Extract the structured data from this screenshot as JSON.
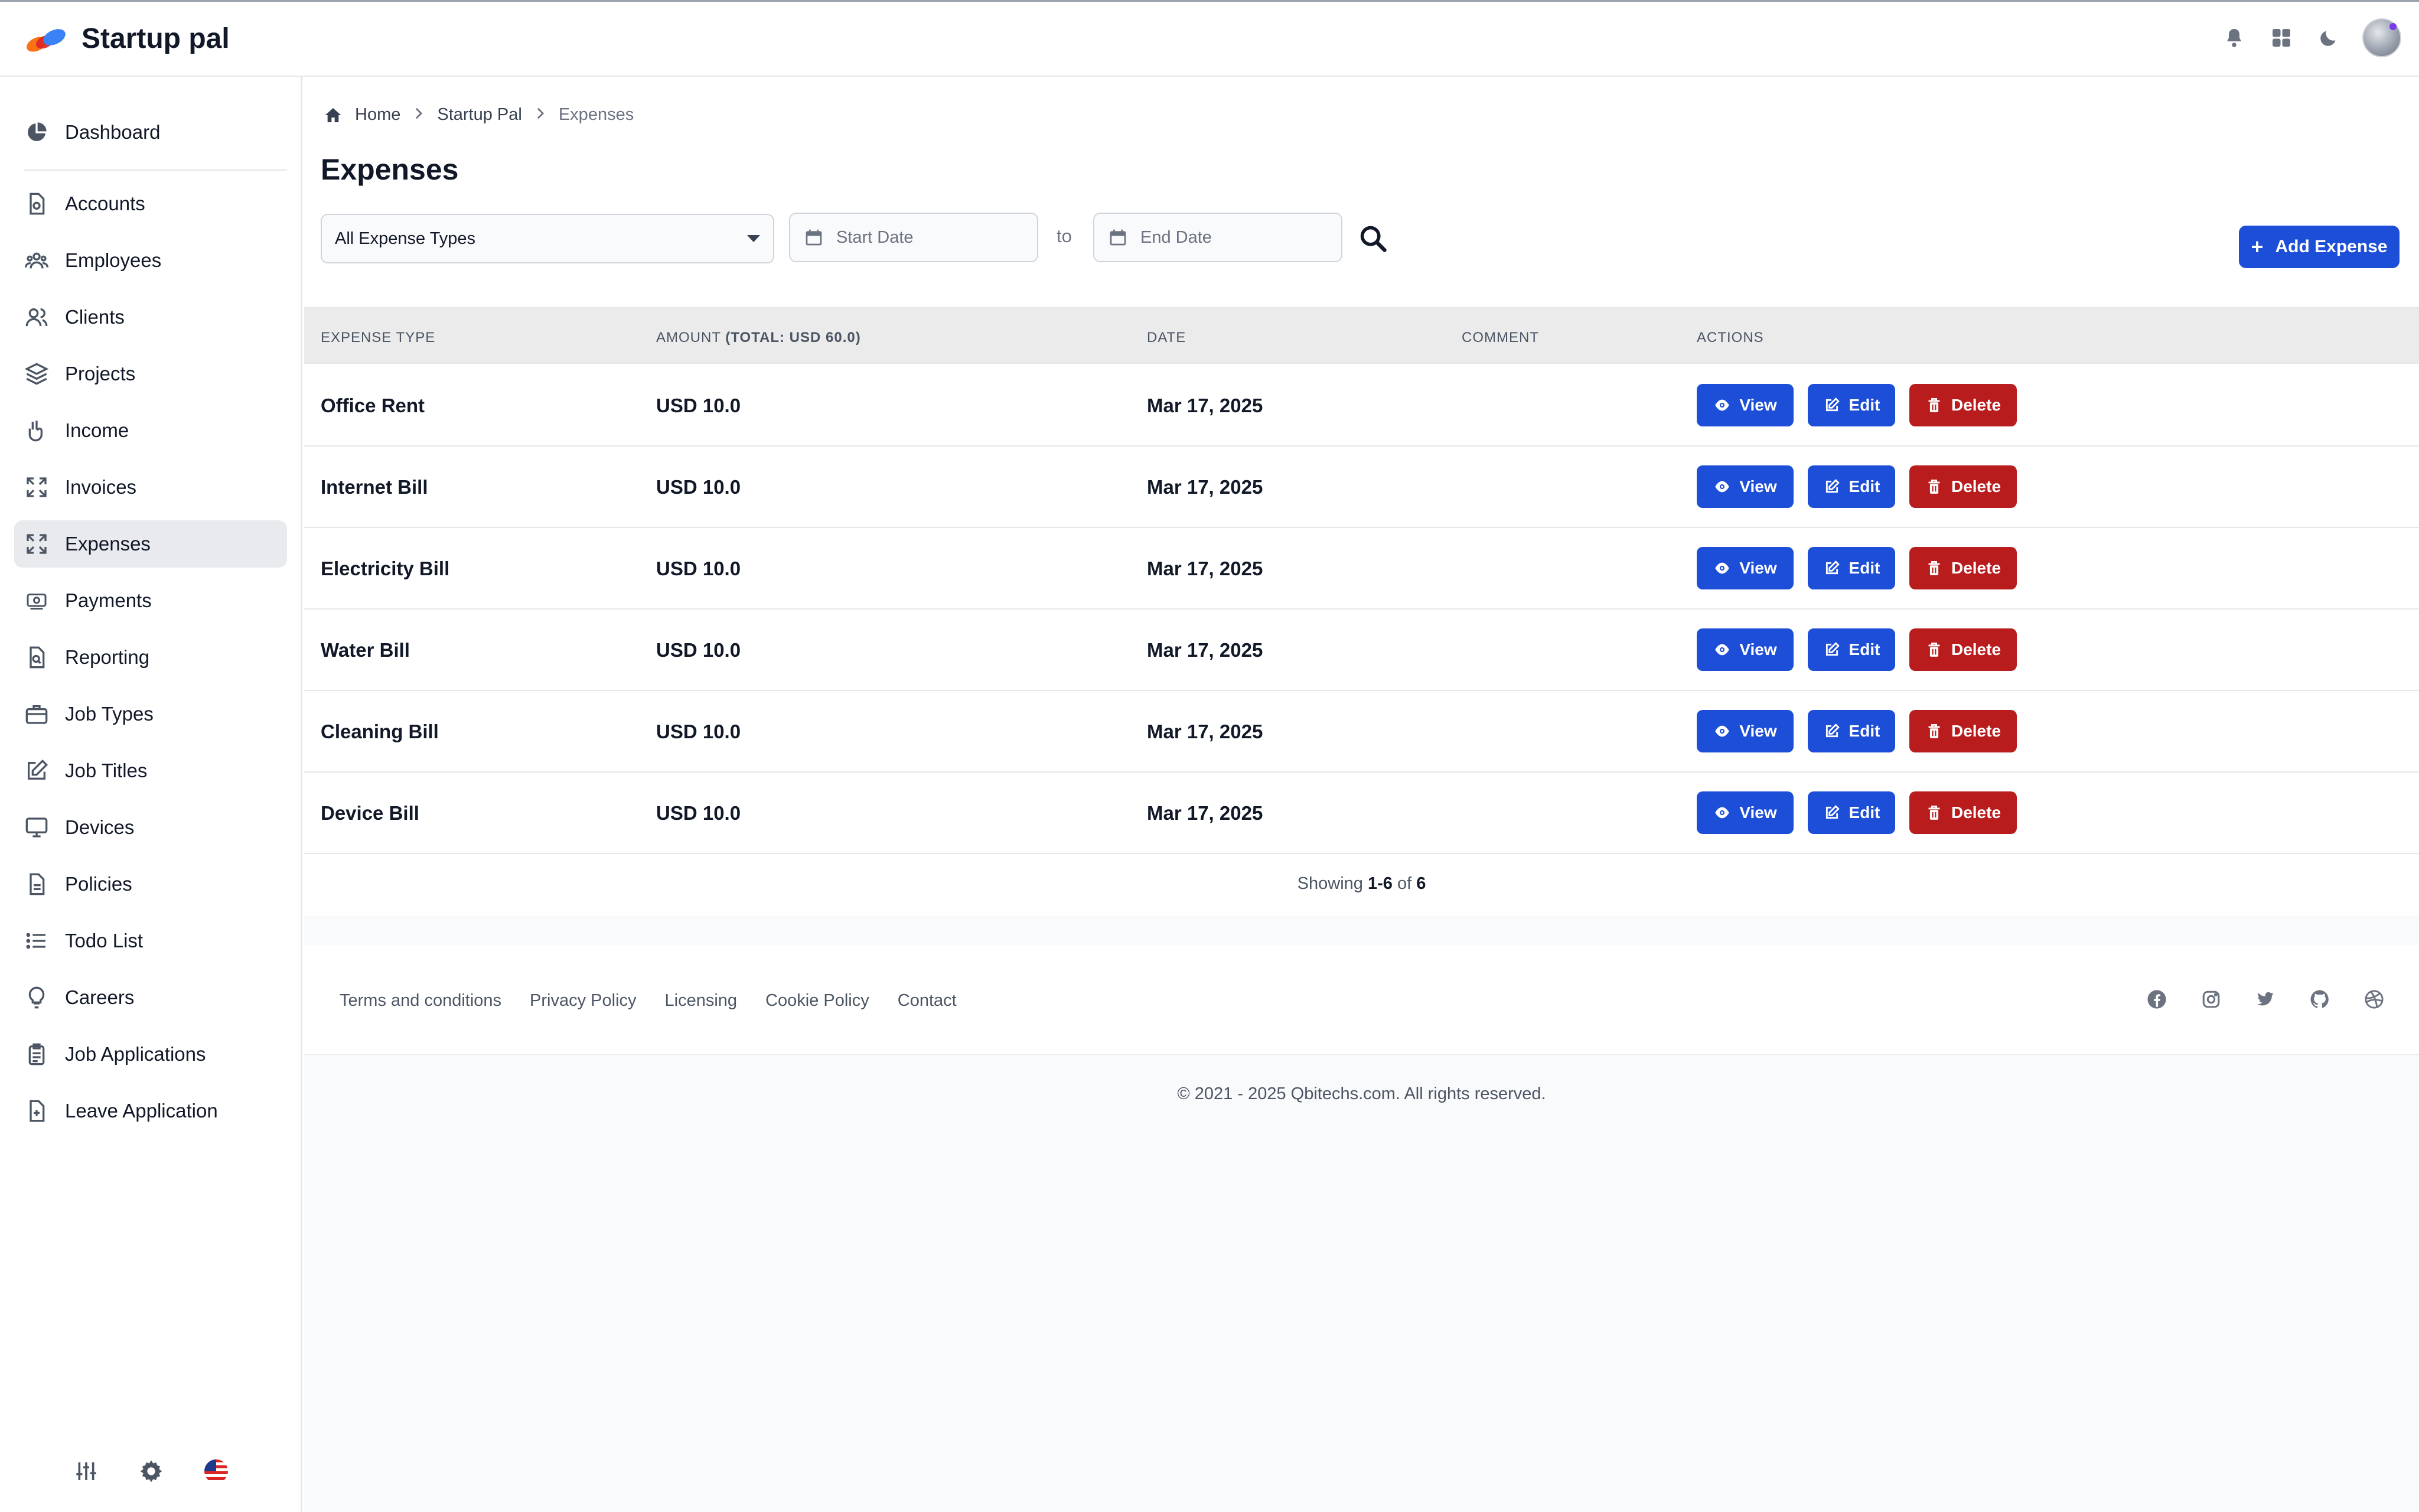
{
  "app": {
    "name": "Startup pal"
  },
  "sidebar": {
    "items": [
      {
        "label": "Dashboard",
        "icon": "pie-chart-icon"
      },
      {
        "label": "Accounts",
        "icon": "document-icon"
      },
      {
        "label": "Employees",
        "icon": "users-icon"
      },
      {
        "label": "Clients",
        "icon": "user-group-icon"
      },
      {
        "label": "Projects",
        "icon": "layers-icon"
      },
      {
        "label": "Income",
        "icon": "hand-coin-icon"
      },
      {
        "label": "Invoices",
        "icon": "expand-icon"
      },
      {
        "label": "Expenses",
        "icon": "expand-icon"
      },
      {
        "label": "Payments",
        "icon": "cash-icon"
      },
      {
        "label": "Reporting",
        "icon": "document-search-icon"
      },
      {
        "label": "Job Types",
        "icon": "briefcase-icon"
      },
      {
        "label": "Job Titles",
        "icon": "pencil-square-icon"
      },
      {
        "label": "Devices",
        "icon": "monitor-icon"
      },
      {
        "label": "Policies",
        "icon": "file-text-icon"
      },
      {
        "label": "Todo List",
        "icon": "list-icon"
      },
      {
        "label": "Careers",
        "icon": "lightbulb-icon"
      },
      {
        "label": "Job Applications",
        "icon": "clipboard-icon"
      },
      {
        "label": "Leave Application",
        "icon": "file-plus-icon"
      }
    ],
    "active": "Expenses"
  },
  "breadcrumb": {
    "home": "Home",
    "section": "Startup Pal",
    "current": "Expenses"
  },
  "page": {
    "title": "Expenses"
  },
  "filters": {
    "expense_type": "All Expense Types",
    "start_placeholder": "Start Date",
    "end_placeholder": "End Date",
    "to_label": "to"
  },
  "add_button": {
    "label": "Add Expense"
  },
  "table": {
    "headers": {
      "type": "EXPENSE TYPE",
      "amount": "AMOUNT",
      "amount_total": "(TOTAL: USD 60.0)",
      "date": "DATE",
      "comment": "COMMENT",
      "actions": "ACTIONS"
    },
    "rows": [
      {
        "type": "Office Rent",
        "amount": "USD 10.0",
        "date": "Mar 17, 2025",
        "comment": ""
      },
      {
        "type": "Internet Bill",
        "amount": "USD 10.0",
        "date": "Mar 17, 2025",
        "comment": ""
      },
      {
        "type": "Electricity Bill",
        "amount": "USD 10.0",
        "date": "Mar 17, 2025",
        "comment": ""
      },
      {
        "type": "Water Bill",
        "amount": "USD 10.0",
        "date": "Mar 17, 2025",
        "comment": ""
      },
      {
        "type": "Cleaning Bill",
        "amount": "USD 10.0",
        "date": "Mar 17, 2025",
        "comment": ""
      },
      {
        "type": "Device Bill",
        "amount": "USD 10.0",
        "date": "Mar 17, 2025",
        "comment": ""
      }
    ],
    "actions": {
      "view": "View",
      "edit": "Edit",
      "delete": "Delete"
    }
  },
  "pagination": {
    "prefix": "Showing",
    "range": "1-6",
    "of": "of",
    "total": "6"
  },
  "footer": {
    "links": [
      "Terms and conditions",
      "Privacy Policy",
      "Licensing",
      "Cookie Policy",
      "Contact"
    ],
    "social": [
      "facebook-icon",
      "instagram-icon",
      "twitter-icon",
      "github-icon",
      "dribbble-icon"
    ],
    "copyright": "© 2021 - 2025 Qbitechs.com. All rights reserved."
  },
  "colors": {
    "primary": "#1d4ed8",
    "danger": "#b91c1c",
    "active_nav": "#e9eaee"
  }
}
